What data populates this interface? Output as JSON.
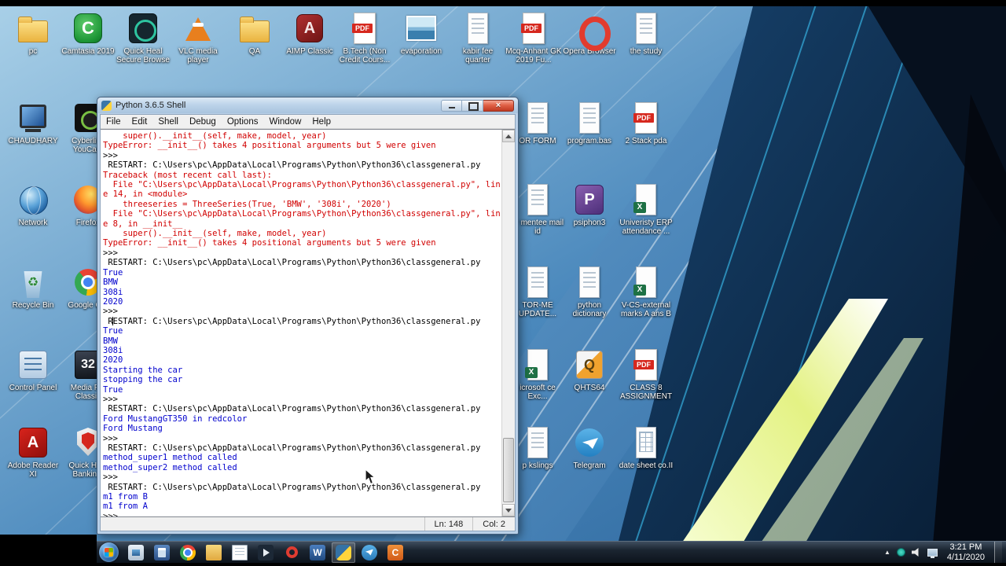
{
  "desktop": {
    "icons": [
      {
        "label": "pc",
        "icon": "folder-icon"
      },
      {
        "label": "Camtasia 2019",
        "icon": "camtasia-icon"
      },
      {
        "label": "Quick Heal Secure Browse",
        "icon": "secure-browser-icon"
      },
      {
        "label": "VLC media player",
        "icon": "vlc-cone-icon"
      },
      {
        "label": "QA",
        "icon": "folder-icon"
      },
      {
        "label": "AIMP Classic",
        "icon": "aimp-icon"
      },
      {
        "label": "B.Tech (Non Credit Cours...",
        "icon": "pdf-icon"
      },
      {
        "label": "evaporation",
        "icon": "image-icon"
      },
      {
        "label": "kabir fee quarter",
        "icon": "document-icon"
      },
      {
        "label": "Mcq-Anhant GK 2019 Fu...",
        "icon": "pdf-icon"
      },
      {
        "label": "Opera Browser",
        "icon": "opera-icon"
      },
      {
        "label": "the study",
        "icon": "document-icon"
      },
      {
        "label": "CHAUDHARY",
        "icon": "computer-icon"
      },
      {
        "label": "Cyberlink YouCam",
        "icon": "youcam-icon"
      },
      {
        "label": "OR FORM",
        "icon": "document-icon"
      },
      {
        "label": "program.bas",
        "icon": "document-icon"
      },
      {
        "label": "2 Stack pda",
        "icon": "pdf-icon"
      },
      {
        "label": "Network",
        "icon": "network-globe-icon"
      },
      {
        "label": "Firefox",
        "icon": "firefox-icon"
      },
      {
        "label": "or mentee mail id",
        "icon": "document-icon"
      },
      {
        "label": "psiphon3",
        "icon": "psiphon-icon"
      },
      {
        "label": "Univeristy ERP attendance ...",
        "icon": "excel-icon"
      },
      {
        "label": "Recycle Bin",
        "icon": "recycle-bin-icon"
      },
      {
        "label": "Google Chr",
        "icon": "chrome-icon"
      },
      {
        "label": "TOR-ME UPDATE...",
        "icon": "document-icon"
      },
      {
        "label": "python dictionary",
        "icon": "document-icon"
      },
      {
        "label": "V-CS-external marks A ans B",
        "icon": "excel-icon"
      },
      {
        "label": "Control Panel",
        "icon": "control-panel-icon"
      },
      {
        "label": "Media Pla Classic",
        "icon": "media-player-classic-icon"
      },
      {
        "label": "icrosoft ce Exc...",
        "icon": "excel-icon"
      },
      {
        "label": "QHTS64",
        "icon": "qhts-icon"
      },
      {
        "label": "CLASS 8 ASSIGNMENT",
        "icon": "pdf-icon"
      },
      {
        "label": "Adobe Reader XI",
        "icon": "adobe-reader-icon"
      },
      {
        "label": "Quick Heal Bankin...",
        "icon": "quick-heal-shield-icon"
      },
      {
        "label": "p kslings",
        "icon": "document-icon"
      },
      {
        "label": "Telegram",
        "icon": "telegram-icon"
      },
      {
        "label": "date sheet co.II",
        "icon": "spreadsheet-doc-icon"
      }
    ]
  },
  "window": {
    "title": "Python 3.6.5 Shell",
    "menus": [
      "File",
      "Edit",
      "Shell",
      "Debug",
      "Options",
      "Window",
      "Help"
    ],
    "status": {
      "line": "Ln: 148",
      "col": "Col: 2"
    },
    "shell_lines": [
      {
        "t": "    super().__init__(self, make, model, year)",
        "c": "err"
      },
      {
        "t": "TypeError: __init__() takes 4 positional arguments but 5 were given",
        "c": "err"
      },
      {
        "t": ">>> ",
        "c": "std"
      },
      {
        "t": " RESTART: C:\\Users\\pc\\AppData\\Local\\Programs\\Python\\Python36\\classgeneral.py ",
        "c": "std"
      },
      {
        "t": "Traceback (most recent call last):",
        "c": "err"
      },
      {
        "t": "  File \"C:\\Users\\pc\\AppData\\Local\\Programs\\Python\\Python36\\classgeneral.py\", lin",
        "c": "err"
      },
      {
        "t": "e 14, in <module>",
        "c": "err"
      },
      {
        "t": "    threeseries = ThreeSeries(True, 'BMW', '308i', '2020')",
        "c": "err"
      },
      {
        "t": "  File \"C:\\Users\\pc\\AppData\\Local\\Programs\\Python\\Python36\\classgeneral.py\", lin",
        "c": "err"
      },
      {
        "t": "e 8, in __init__",
        "c": "err"
      },
      {
        "t": "    super().__init__(self, make, model, year)",
        "c": "err"
      },
      {
        "t": "TypeError: __init__() takes 4 positional arguments but 5 were given",
        "c": "err"
      },
      {
        "t": ">>> ",
        "c": "std"
      },
      {
        "t": " RESTART: C:\\Users\\pc\\AppData\\Local\\Programs\\Python\\Python36\\classgeneral.py ",
        "c": "std"
      },
      {
        "t": "True",
        "c": "out"
      },
      {
        "t": "BMW",
        "c": "out"
      },
      {
        "t": "308i",
        "c": "out"
      },
      {
        "t": "2020",
        "c": "out"
      },
      {
        "t": ">>> ",
        "c": "std"
      },
      {
        "t": " RESTART: C:\\Users\\pc\\AppData\\Local\\Programs\\Python\\Python36\\classgeneral.py ",
        "c": "std"
      },
      {
        "t": "True",
        "c": "out"
      },
      {
        "t": "BMW",
        "c": "out"
      },
      {
        "t": "308i",
        "c": "out"
      },
      {
        "t": "2020",
        "c": "out"
      },
      {
        "t": "Starting the car",
        "c": "out"
      },
      {
        "t": "stopping the car",
        "c": "out"
      },
      {
        "t": "True",
        "c": "out"
      },
      {
        "t": ">>> ",
        "c": "std"
      },
      {
        "t": " RESTART: C:\\Users\\pc\\AppData\\Local\\Programs\\Python\\Python36\\classgeneral.py ",
        "c": "std"
      },
      {
        "t": "Ford MustangGT350 in redcolor",
        "c": "out"
      },
      {
        "t": "Ford Mustang",
        "c": "out"
      },
      {
        "t": ">>> ",
        "c": "std"
      },
      {
        "t": " RESTART: C:\\Users\\pc\\AppData\\Local\\Programs\\Python\\Python36\\classgeneral.py ",
        "c": "std"
      },
      {
        "t": "method_super1 method called",
        "c": "out"
      },
      {
        "t": "method_super2 method called",
        "c": "out"
      },
      {
        "t": ">>> ",
        "c": "std"
      },
      {
        "t": " RESTART: C:\\Users\\pc\\AppData\\Local\\Programs\\Python\\Python36\\classgeneral.py ",
        "c": "std"
      },
      {
        "t": "m1 from B",
        "c": "out"
      },
      {
        "t": "m1 from A",
        "c": "out"
      },
      {
        "t": ">>> ",
        "c": "std"
      }
    ]
  },
  "taskbar": {
    "time": "3:21 PM",
    "date": "4/11/2020",
    "buttons": [
      "photos",
      "calculator",
      "chrome",
      "file-explorer",
      "notepad",
      "media-player-classic",
      "opera",
      "word",
      "python-idle",
      "telegram",
      "camtasia"
    ]
  }
}
